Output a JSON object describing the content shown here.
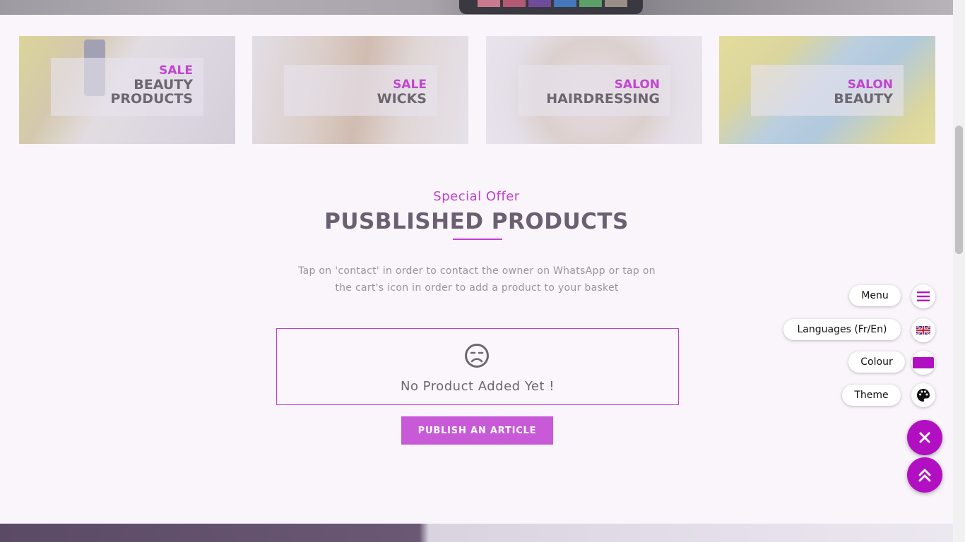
{
  "categories": [
    {
      "kicker": "SALE",
      "title_line1": "BEAUTY",
      "title_line2": "PRODUCTS"
    },
    {
      "kicker": "SALE",
      "title_line1": "WICKS"
    },
    {
      "kicker": "SALON",
      "title_line1": "HAIRDRESSING"
    },
    {
      "kicker": "SALON",
      "title_line1": "BEAUTY"
    }
  ],
  "section": {
    "kicker": "Special Offer",
    "title": "PUSBLISHED PRODUCTS",
    "description_line1": "Tap on 'contact' in order to contact the owner on WhatsApp or tap on",
    "description_line2": "the cart's icon in order to add a product to your basket"
  },
  "empty_state": {
    "icon": "frown-face-icon",
    "text": "No Product Added Yet !"
  },
  "publish_button": "PUBLISH AN ARTICLE",
  "floating_menu": {
    "menu_label": "Menu",
    "languages_label": "Languages (Fr/En)",
    "colour_label": "Colour",
    "theme_label": "Theme"
  },
  "colors": {
    "accent": "#c23fd1",
    "fab": "#b20fc3",
    "button": "#c85ad8"
  }
}
